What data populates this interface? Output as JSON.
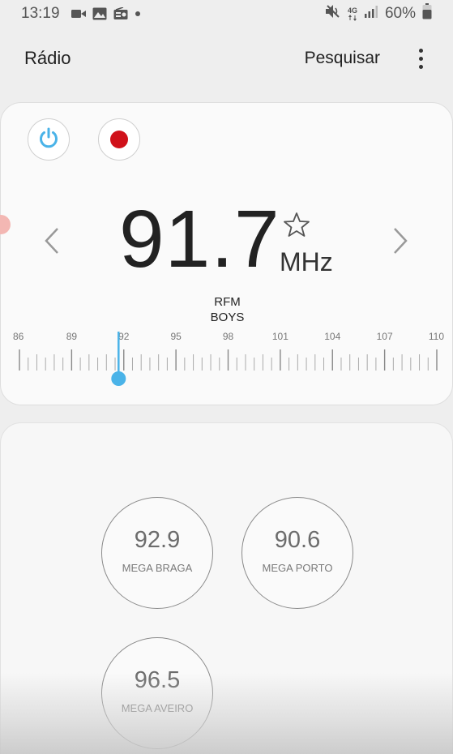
{
  "status_bar": {
    "time": "13:19",
    "network": "4G",
    "battery": "60%"
  },
  "app_bar": {
    "title": "Rádio",
    "search_label": "Pesquisar"
  },
  "tuner": {
    "frequency": "91.7",
    "unit": "MHz",
    "station_line1": "RFM",
    "station_line2": "BOYS",
    "scale_labels": [
      "86",
      "89",
      "92",
      "95",
      "98",
      "101",
      "104",
      "107",
      "110"
    ],
    "scale_min": 86,
    "scale_max": 110,
    "current_value": 91.7,
    "accent_color": "#4ab3e8",
    "record_color": "#d0111a"
  },
  "favorites": [
    {
      "frequency": "92.9",
      "name": "MEGA BRAGA"
    },
    {
      "frequency": "90.6",
      "name": "MEGA PORTO"
    },
    {
      "frequency": "96.5",
      "name": "MEGA AVEIRO"
    }
  ]
}
